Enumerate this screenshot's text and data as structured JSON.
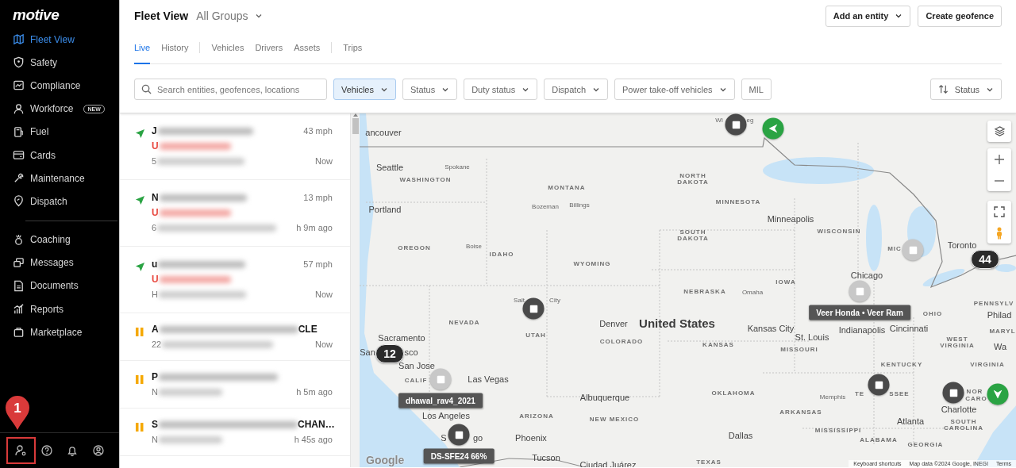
{
  "sidebar": {
    "logo": "motive",
    "nav_sections": [
      [
        {
          "label": "Fleet View",
          "selected": true
        },
        {
          "label": "Safety",
          "selected": false
        },
        {
          "label": "Compliance",
          "selected": false
        },
        {
          "label": "Workforce",
          "selected": false,
          "badge": "NEW"
        },
        {
          "label": "Fuel",
          "selected": false
        },
        {
          "label": "Cards",
          "selected": false
        },
        {
          "label": "Maintenance",
          "selected": false
        },
        {
          "label": "Dispatch",
          "selected": false
        }
      ],
      [
        {
          "label": "Coaching",
          "selected": false
        },
        {
          "label": "Messages",
          "selected": false
        },
        {
          "label": "Documents",
          "selected": false
        },
        {
          "label": "Reports",
          "selected": false
        },
        {
          "label": "Marketplace",
          "selected": false
        }
      ]
    ],
    "footer_icons": [
      {
        "highlighted": true
      },
      {
        "highlighted": false
      },
      {
        "highlighted": false
      },
      {
        "highlighted": false
      }
    ],
    "annotation": "1"
  },
  "header": {
    "title": "Fleet View",
    "group_selector": "All Groups",
    "actions": [
      {
        "label": "Add an entity",
        "dropdown": true
      },
      {
        "label": "Create geofence",
        "dropdown": false
      }
    ]
  },
  "tab_groups": [
    [
      {
        "label": "Live",
        "selected": true
      },
      {
        "label": "History",
        "selected": false
      }
    ],
    [
      {
        "label": "Vehicles",
        "selected": false
      },
      {
        "label": "Drivers",
        "selected": false
      },
      {
        "label": "Assets",
        "selected": false
      }
    ],
    [
      {
        "label": "Trips",
        "selected": false
      }
    ]
  ],
  "filters": {
    "search": {
      "placeholder": "Search entities, geofences, locations"
    },
    "chips": [
      {
        "label": "Vehicles",
        "selected": true,
        "dropdown": true
      },
      {
        "label": "Status",
        "selected": false,
        "dropdown": true
      },
      {
        "label": "Duty status",
        "selected": false,
        "dropdown": true
      },
      {
        "label": "Dispatch",
        "selected": false,
        "dropdown": true
      },
      {
        "label": "Power take-off vehicles",
        "selected": false,
        "dropdown": true
      },
      {
        "label": "MIL",
        "selected": false,
        "dropdown": false
      }
    ],
    "sort": {
      "label": "Status"
    }
  },
  "vehicles": [
    {
      "kind": "moving",
      "name": "J",
      "status": "U",
      "address": "5",
      "speed": "43 mph",
      "time": "Now"
    },
    {
      "kind": "moving",
      "name": "N",
      "status": "U",
      "address": "6",
      "speed": "13 mph",
      "time": "h 9m ago"
    },
    {
      "kind": "moving",
      "name": "u",
      "status": "U",
      "address": "H",
      "speed": "57 mph",
      "time": "Now"
    },
    {
      "kind": "paused",
      "name": "A",
      "name_end": "CLE",
      "address": "22",
      "time": "Now"
    },
    {
      "kind": "paused",
      "name": "P",
      "address": "N",
      "time": "h 5m ago"
    },
    {
      "kind": "paused",
      "name": "S",
      "name_end": "CHAN…",
      "address": "N",
      "time": "h 45s ago"
    }
  ],
  "map": {
    "labels": [
      {
        "text": "Wi",
        "kind": "town"
      },
      {
        "text": "eg",
        "kind": "town"
      },
      {
        "text": "ancouver",
        "kind": "city"
      },
      {
        "text": "Seattle",
        "kind": "city"
      },
      {
        "text": "Spokane",
        "kind": "town"
      },
      {
        "text": "WASHINGTON",
        "kind": "state"
      },
      {
        "text": "Portland",
        "kind": "city"
      },
      {
        "text": "MONTANA",
        "kind": "state"
      },
      {
        "text": "Bozeman",
        "kind": "town"
      },
      {
        "text": "Billings",
        "kind": "town"
      },
      {
        "text": "NORTH DAKOTA",
        "kind": "state-wrap"
      },
      {
        "text": "MINNESOTA",
        "kind": "state"
      },
      {
        "text": "Minneapolis",
        "kind": "city"
      },
      {
        "text": "WISCONSIN",
        "kind": "state"
      },
      {
        "text": "SOUTH DAKOTA",
        "kind": "state-wrap"
      },
      {
        "text": "OREGON",
        "kind": "state"
      },
      {
        "text": "Boise",
        "kind": "town"
      },
      {
        "text": "IDAHO",
        "kind": "state"
      },
      {
        "text": "WYOMING",
        "kind": "state"
      },
      {
        "text": "MIC",
        "kind": "state"
      },
      {
        "text": "Toronto",
        "kind": "city"
      },
      {
        "text": "NEBRASKA",
        "kind": "state"
      },
      {
        "text": "Omaha",
        "kind": "town"
      },
      {
        "text": "IOWA",
        "kind": "state"
      },
      {
        "text": "Chicago",
        "kind": "city"
      },
      {
        "text": "Salt",
        "kind": "town"
      },
      {
        "text": "City",
        "kind": "town"
      },
      {
        "text": "NEVADA",
        "kind": "state"
      },
      {
        "text": "Denver",
        "kind": "city"
      },
      {
        "text": "United States",
        "kind": "country"
      },
      {
        "text": "UTAH",
        "kind": "state"
      },
      {
        "text": "COLORADO",
        "kind": "state"
      },
      {
        "text": "KANSAS",
        "kind": "state"
      },
      {
        "text": "Kansas City",
        "kind": "city"
      },
      {
        "text": "St. Louis",
        "kind": "city"
      },
      {
        "text": "Indianapolis",
        "kind": "city"
      },
      {
        "text": "Cincinnati",
        "kind": "city"
      },
      {
        "text": "OHIO",
        "kind": "state"
      },
      {
        "text": "PENNSYLV",
        "kind": "state"
      },
      {
        "text": "Philad",
        "kind": "city"
      },
      {
        "text": "MISSOURI",
        "kind": "state"
      },
      {
        "text": "Sacramento",
        "kind": "city"
      },
      {
        "text": "San",
        "kind": "city"
      },
      {
        "text": "sco",
        "kind": "city"
      },
      {
        "text": "San Jose",
        "kind": "city"
      },
      {
        "text": "CALIF",
        "kind": "state"
      },
      {
        "text": "Las Vegas",
        "kind": "city"
      },
      {
        "text": "MARYL",
        "kind": "state"
      },
      {
        "text": "WEST VIRGINIA",
        "kind": "state-wrap"
      },
      {
        "text": "Wa",
        "kind": "city"
      },
      {
        "text": "KENTUCKY",
        "kind": "state"
      },
      {
        "text": "VIRGINIA",
        "kind": "state"
      },
      {
        "text": "OKLAHOMA",
        "kind": "state"
      },
      {
        "text": "Memphis",
        "kind": "town"
      },
      {
        "text": "TE",
        "kind": "state"
      },
      {
        "text": "SSEE",
        "kind": "state"
      },
      {
        "text": "Albuquerque",
        "kind": "city"
      },
      {
        "text": "NOR",
        "kind": "state"
      },
      {
        "text": "CARO",
        "kind": "state"
      },
      {
        "text": "Charlotte",
        "kind": "city"
      },
      {
        "text": "Los Angeles",
        "kind": "city"
      },
      {
        "text": "ARIZONA",
        "kind": "state"
      },
      {
        "text": "NEW MEXICO",
        "kind": "state"
      },
      {
        "text": "ARKANSAS",
        "kind": "state"
      },
      {
        "text": "Atlanta",
        "kind": "city"
      },
      {
        "text": "SOUTH CAROLINA",
        "kind": "state-wrap"
      },
      {
        "text": "S",
        "kind": "city"
      },
      {
        "text": "go",
        "kind": "city"
      },
      {
        "text": "Phoenix",
        "kind": "city"
      },
      {
        "text": "MISSISSIPPI",
        "kind": "state"
      },
      {
        "text": "ALABAMA",
        "kind": "state"
      },
      {
        "text": "Dallas",
        "kind": "city"
      },
      {
        "text": "GEORGIA",
        "kind": "state"
      },
      {
        "text": "Tucson",
        "kind": "city"
      },
      {
        "text": "TEXAS",
        "kind": "state"
      },
      {
        "text": "Ciudad Juárez",
        "kind": "city"
      }
    ],
    "markers": [
      {
        "kind": "stopped"
      },
      {
        "kind": "moving_west"
      },
      {
        "kind": "cluster",
        "count": "44"
      },
      {
        "kind": "idle"
      },
      {
        "kind": "idle",
        "label": "Veer Honda • Veer Ram"
      },
      {
        "kind": "stopped"
      },
      {
        "kind": "cluster",
        "count": "12"
      },
      {
        "kind": "idle",
        "label": "dhawal_rav4_2021"
      },
      {
        "kind": "stopped",
        "label": "DS-SFE24 66%"
      },
      {
        "kind": "stopped"
      },
      {
        "kind": "stopped"
      },
      {
        "kind": "moving_south"
      }
    ],
    "google_logo": "Google",
    "attribution": [
      "Keyboard shortcuts",
      "Map data ©2024 Google, INEGI",
      "Terms"
    ]
  }
}
